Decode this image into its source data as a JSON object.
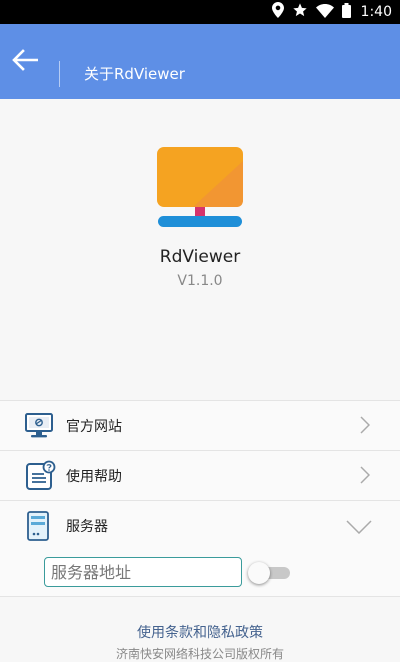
{
  "status_bar": {
    "time": "1:40",
    "icons": [
      "location-icon",
      "star-icon",
      "wifi-icon",
      "battery-icon"
    ]
  },
  "app_bar": {
    "title": "关于RdViewer",
    "color": "#5e8fe6"
  },
  "app_info": {
    "name": "RdViewer",
    "version": "V1.1.0",
    "logo_colors": {
      "screen": "#f5a321",
      "stand": "#d6336c",
      "base": "#1f8fd8"
    }
  },
  "menu": {
    "items": [
      {
        "label": "官方网站",
        "icon": "website-monitor-icon",
        "indicator": "chevron-right-icon"
      },
      {
        "label": "使用帮助",
        "icon": "help-document-icon",
        "indicator": "chevron-right-icon"
      },
      {
        "label": "服务器",
        "icon": "server-icon",
        "indicator": "chevron-down-icon"
      }
    ]
  },
  "server": {
    "placeholder": "服务器地址",
    "value": "",
    "toggle_on": false
  },
  "footer": {
    "policy_link": "使用条款和隐私政策",
    "copyright": "济南快安网络科技公司版权所有"
  }
}
